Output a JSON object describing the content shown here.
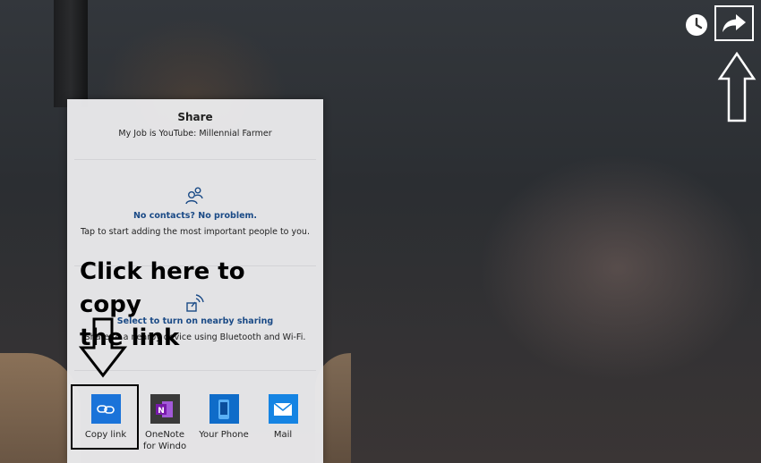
{
  "share_panel": {
    "title": "Share",
    "subtitle": "My Job is YouTube: Millennial Farmer",
    "contacts": {
      "icon": "contacts-icon",
      "link": "No contacts? No problem.",
      "description": "Tap to start adding the most important people to you."
    },
    "nearby": {
      "icon": "nearby-sharing-icon",
      "link": "Select to turn on nearby sharing",
      "description": "Share to a nearby device using Bluetooth and Wi-Fi."
    },
    "apps": [
      {
        "label": "Copy link",
        "icon": "link-icon",
        "color": "#1a73d9"
      },
      {
        "label": "OneNote for Windows",
        "label_line1": "OneNote",
        "label_line2": "for Windo",
        "icon": "onenote-icon",
        "color": "#7719aa"
      },
      {
        "label": "Your Phone",
        "icon": "phone-icon",
        "color": "#0f6cc9"
      },
      {
        "label": "Mail",
        "icon": "mail-icon",
        "color": "#1584e3"
      }
    ]
  },
  "top_controls": {
    "watch_later_icon": "clock-icon",
    "share_icon": "share-arrow-icon"
  },
  "annotation": {
    "line1": "Click here to copy",
    "line2": "the link"
  }
}
